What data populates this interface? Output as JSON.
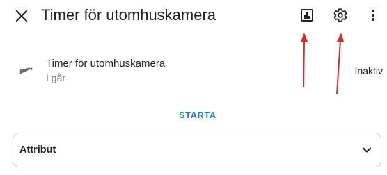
{
  "header": {
    "title": "Timer för utomhuskamera",
    "icons": {
      "close": "close-icon",
      "history": "chart-bar-icon",
      "settings": "gear-icon",
      "more": "dots-vertical-icon"
    }
  },
  "entity": {
    "icon": "cctv-camera-icon",
    "name": "Timer för utomhuskamera",
    "subtitle": "I går",
    "state": "Inaktiv"
  },
  "actions": {
    "start_label": "STARTA"
  },
  "attributes": {
    "label": "Attribut",
    "icon": "chevron-down-icon"
  },
  "annotations": {
    "arrow_color": "#d92b2b",
    "accent_color": "#1c7ac8"
  }
}
